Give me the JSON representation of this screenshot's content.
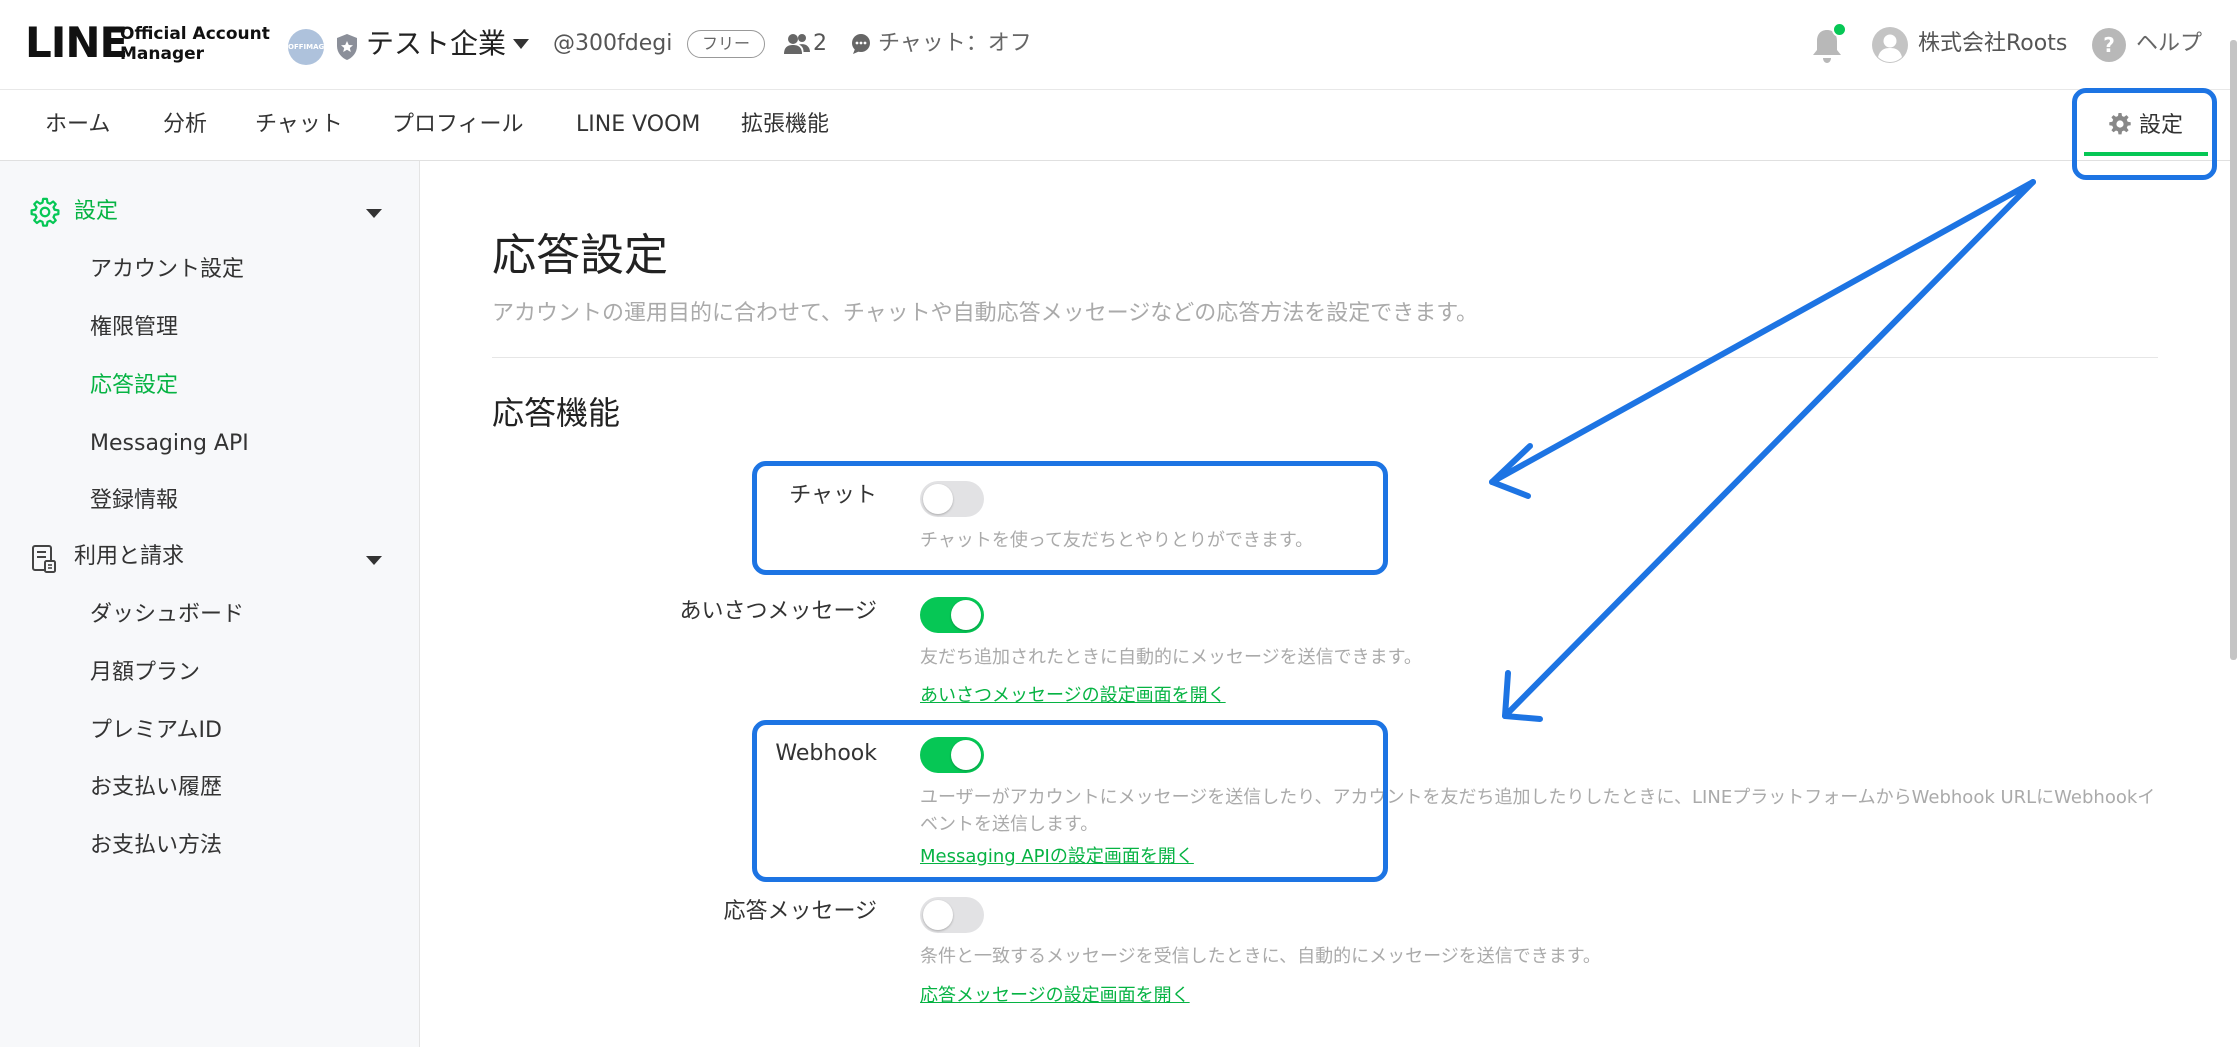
{
  "header": {
    "logo_main": "LINE",
    "logo_sub_line1": "Official Account",
    "logo_sub_line2": "Manager",
    "account_avatar_text": "OFFIMAGE",
    "account_name": "テスト企業",
    "account_id": "@300fdegi",
    "plan_badge": "フリー",
    "friend_count": "2",
    "chat_status": "チャット：オフ",
    "user_name": "株式会社Roots",
    "help_label": "ヘルプ",
    "help_glyph": "?"
  },
  "nav": {
    "items": [
      "ホーム",
      "分析",
      "チャット",
      "プロフィール",
      "LINE VOOM",
      "拡張機能"
    ],
    "settings_label": "設定"
  },
  "sidebar": {
    "settings_section": {
      "label": "設定",
      "items": [
        "アカウント設定",
        "権限管理",
        "応答設定",
        "Messaging API",
        "登録情報"
      ]
    },
    "billing_section": {
      "label": "利用と請求",
      "items": [
        "ダッシュボード",
        "月額プラン",
        "プレミアムID",
        "お支払い履歴",
        "お支払い方法"
      ]
    }
  },
  "main": {
    "title": "応答設定",
    "description": "アカウントの運用目的に合わせて、チャットや自動応答メッセージなどの応答方法を設定できます。",
    "section_title": "応答機能",
    "features": [
      {
        "label": "チャット",
        "enabled": false,
        "desc": "チャットを使って友だちとやりとりができます。",
        "link": ""
      },
      {
        "label": "あいさつメッセージ",
        "enabled": true,
        "desc": "友だち追加されたときに自動的にメッセージを送信できます。",
        "link": "あいさつメッセージの設定画面を開く"
      },
      {
        "label": "Webhook",
        "enabled": true,
        "desc": "ユーザーがアカウントにメッセージを送信したり、アカウントを友だち追加したりしたときに、LINEプラットフォームからWebhook URLにWebhookイベントを送信します。",
        "link": "Messaging APIの設定画面を開く"
      },
      {
        "label": "応答メッセージ",
        "enabled": false,
        "desc": "条件と一致するメッセージを受信したときに、自動的にメッセージを送信できます。",
        "link": "応答メッセージの設定画面を開く"
      }
    ]
  },
  "colors": {
    "brand_green": "#06c755",
    "annotation_blue": "#1d74e3"
  }
}
